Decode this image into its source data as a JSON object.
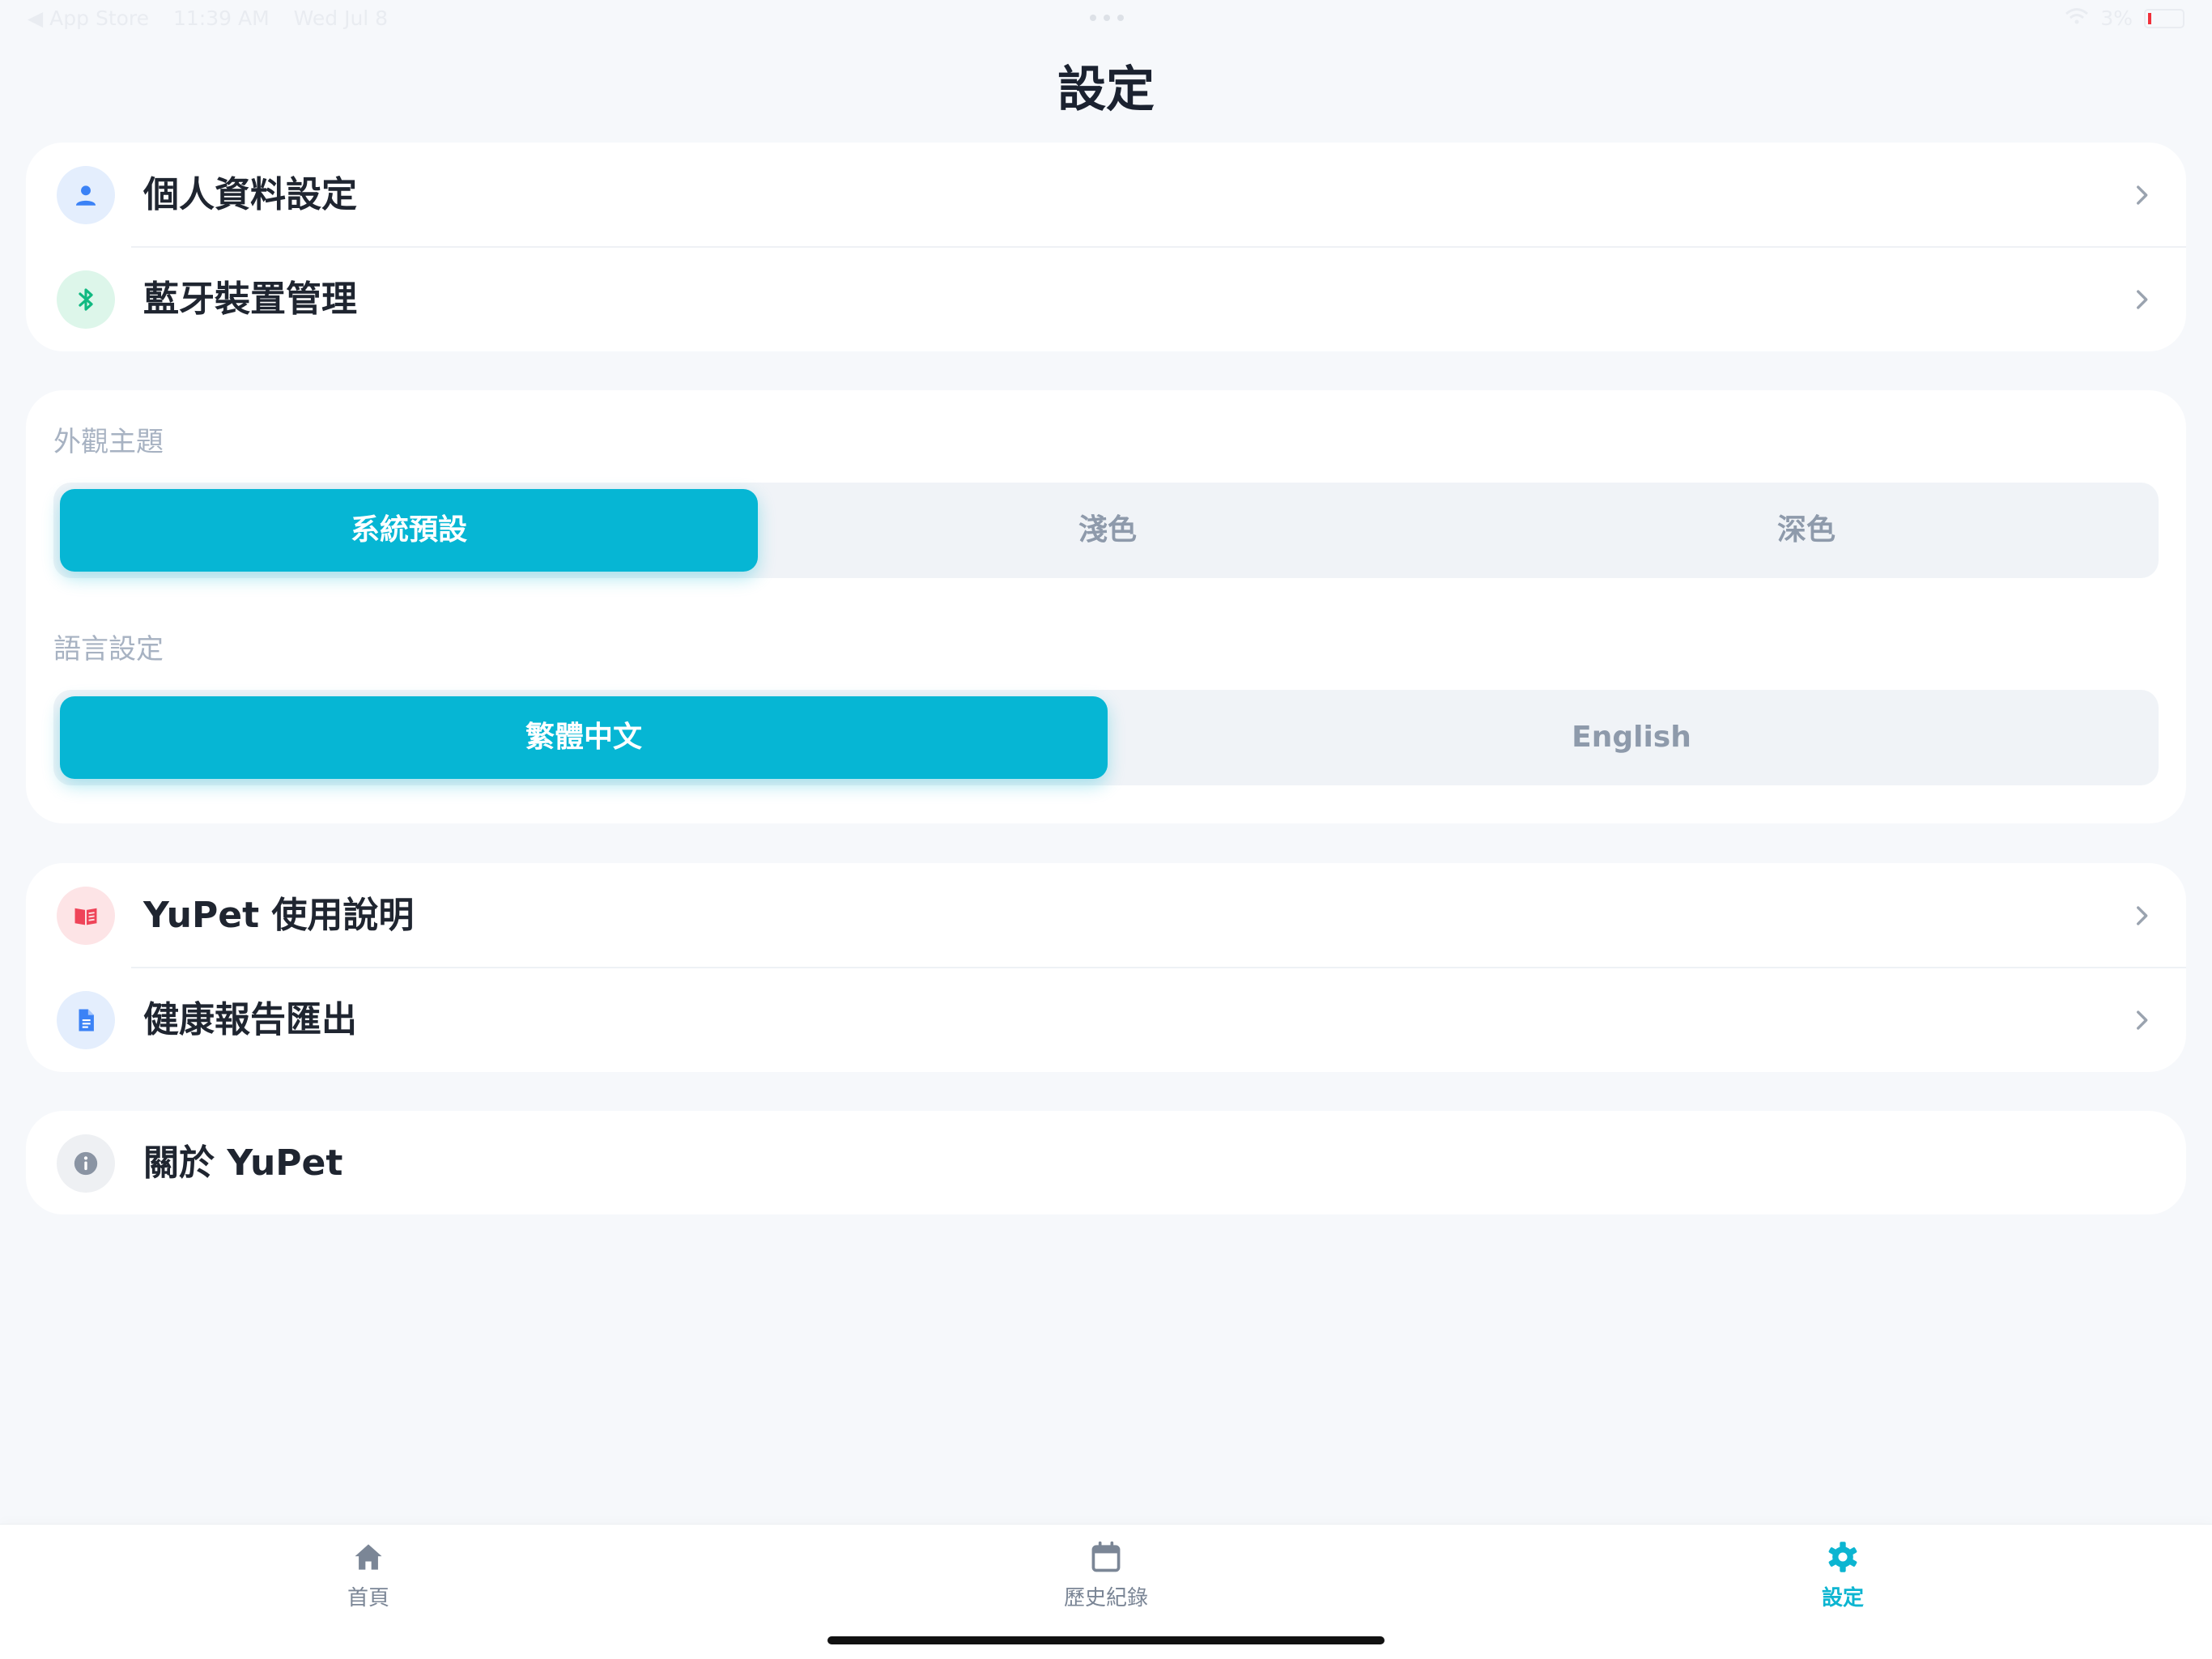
{
  "status_bar": {
    "back_app": "◀ App Store",
    "time": "11:39 AM",
    "date": "Wed Jul 8",
    "battery_text": "3%"
  },
  "page": {
    "title": "設定"
  },
  "account_group": {
    "items": [
      {
        "label": "個人資料設定",
        "icon": "person-icon"
      },
      {
        "label": "藍牙裝置管理",
        "icon": "bluetooth-icon"
      }
    ]
  },
  "preferences": {
    "theme": {
      "label": "外觀主題",
      "options": [
        "系統預設",
        "淺色",
        "深色"
      ],
      "selected": "系統預設"
    },
    "language": {
      "label": "語言設定",
      "options": [
        "繁體中文",
        "English"
      ],
      "selected": "繁體中文"
    }
  },
  "support_group": {
    "items": [
      {
        "label": "YuPet 使用說明",
        "icon": "book-icon"
      },
      {
        "label": "健康報告匯出",
        "icon": "document-icon"
      }
    ]
  },
  "about": {
    "label": "關於 YuPet",
    "icon": "info-icon"
  },
  "tab_bar": {
    "tabs": [
      {
        "label": "首頁",
        "icon": "home-icon"
      },
      {
        "label": "歷史紀錄",
        "icon": "calendar-icon"
      },
      {
        "label": "設定",
        "icon": "gear-icon",
        "active": true
      }
    ]
  },
  "colors": {
    "accent": "#06B6D4",
    "background": "#F6F8FB",
    "card": "#FFFFFF",
    "text_primary": "#1F2530",
    "text_muted": "#A7B2C2"
  }
}
